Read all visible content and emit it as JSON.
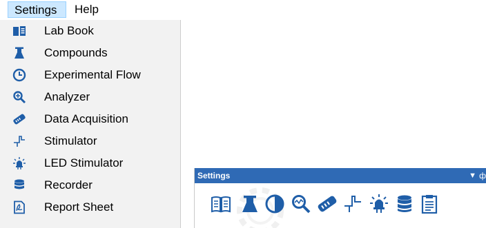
{
  "menubar": {
    "items": [
      {
        "label": "Settings",
        "active": true
      },
      {
        "label": "Help",
        "active": false
      }
    ]
  },
  "dropdown": {
    "items": [
      {
        "label": "Lab Book",
        "icon": "lab-book-icon"
      },
      {
        "label": "Compounds",
        "icon": "flask-icon"
      },
      {
        "label": "Experimental Flow",
        "icon": "clock-icon"
      },
      {
        "label": "Analyzer",
        "icon": "magnifier-icon"
      },
      {
        "label": "Data Acquisition",
        "icon": "acquisition-device-icon"
      },
      {
        "label": "Stimulator",
        "icon": "pulse-icon"
      },
      {
        "label": "LED Stimulator",
        "icon": "led-icon"
      },
      {
        "label": "Recorder",
        "icon": "database-icon"
      },
      {
        "label": "Report Sheet",
        "icon": "report-icon"
      }
    ]
  },
  "panel": {
    "title": "Settings",
    "dropdown_glyph": "▼",
    "pin_glyph": "ф",
    "toolbar": [
      "lab-book-icon",
      "flask-icon",
      "clock-icon",
      "magnifier-icon",
      "acquisition-device-icon",
      "pulse-icon",
      "led-icon",
      "database-icon",
      "clipboard-icon"
    ]
  },
  "colors": {
    "menu_highlight": "#cce8ff",
    "dropdown_bg": "#f2f2f2",
    "panel_title_bg": "#2f6ab5",
    "icon_blue": "#1f5ea8"
  }
}
